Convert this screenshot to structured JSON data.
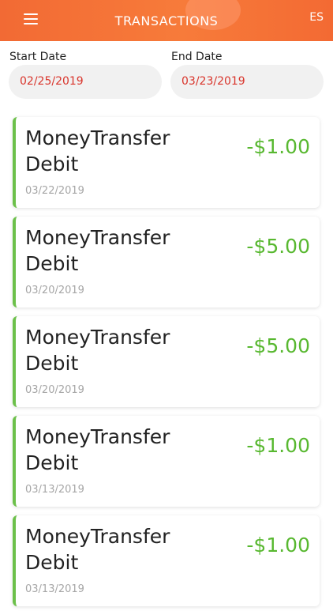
{
  "header": {
    "title": "TRANSACTIONS",
    "language": "ES",
    "menu_icon": "hamburger-menu-icon"
  },
  "filters": {
    "start_label": "Start Date",
    "start_value": "02/25/2019",
    "end_label": "End Date",
    "end_value": "03/23/2019"
  },
  "colors": {
    "header": "#f26a34",
    "accent_green": "#58b830",
    "date_red": "#d9342b"
  },
  "transactions": [
    {
      "description": "MoneyTransfer Debit",
      "amount": "-$1.00",
      "date": "03/22/2019"
    },
    {
      "description": "MoneyTransfer Debit",
      "amount": "-$5.00",
      "date": "03/20/2019"
    },
    {
      "description": "MoneyTransfer Debit",
      "amount": "-$5.00",
      "date": "03/20/2019"
    },
    {
      "description": "MoneyTransfer Debit",
      "amount": "-$1.00",
      "date": "03/13/2019"
    },
    {
      "description": "MoneyTransfer Debit",
      "amount": "-$1.00",
      "date": "03/13/2019"
    }
  ]
}
